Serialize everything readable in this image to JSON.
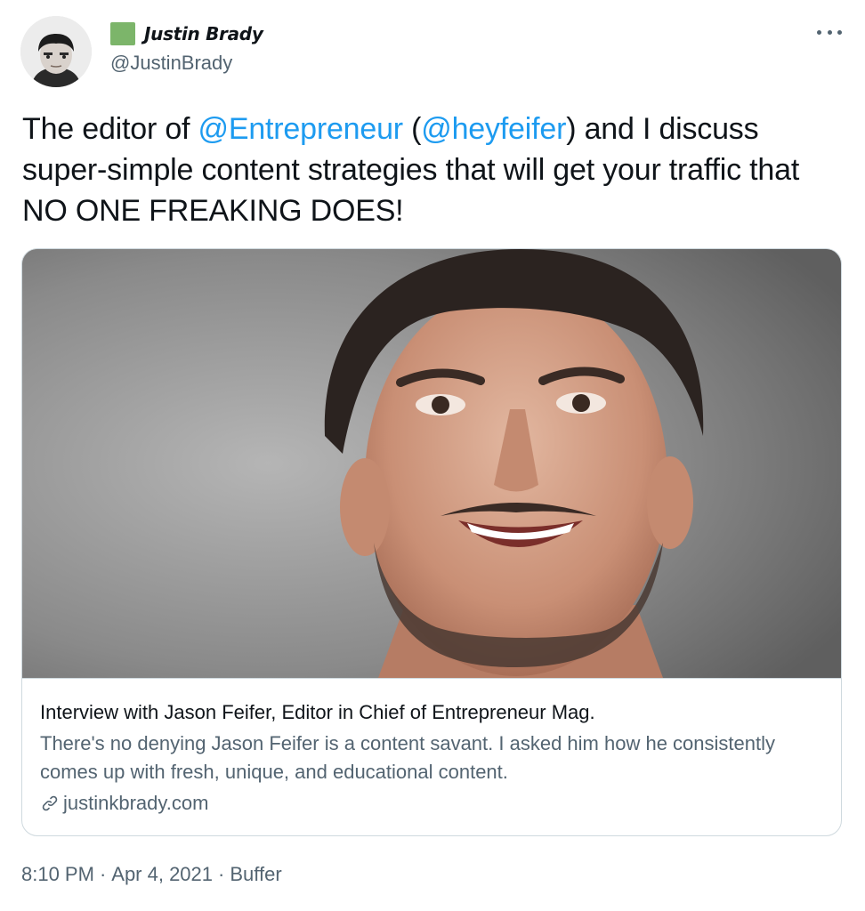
{
  "author": {
    "display_name": "Justin Brady",
    "handle": "@JustinBrady",
    "badge_color": "#7cb56a"
  },
  "more_icon": "more-horizontal-icon",
  "tweet": {
    "text_parts": {
      "p1": "The editor of ",
      "mention1": "@Entrepreneur",
      "p2": " (",
      "mention2": "@heyfeifer",
      "p3": ")  and I discuss super-simple content strategies that will get your traffic that NO ONE FREAKING DOES!"
    },
    "mention_color": "#1d9bf0"
  },
  "card": {
    "title": "Interview with Jason Feifer, Editor in Chief of Entrepreneur Mag.",
    "description": "There's no denying Jason Feifer is a content savant. I asked him how he consistently comes up with fresh, unique, and educational content.",
    "domain": "justinkbrady.com",
    "domain_icon": "link-icon"
  },
  "footer": {
    "time": "8:10 PM",
    "date": "Apr 4, 2021",
    "source": "Buffer",
    "separator": "·"
  }
}
